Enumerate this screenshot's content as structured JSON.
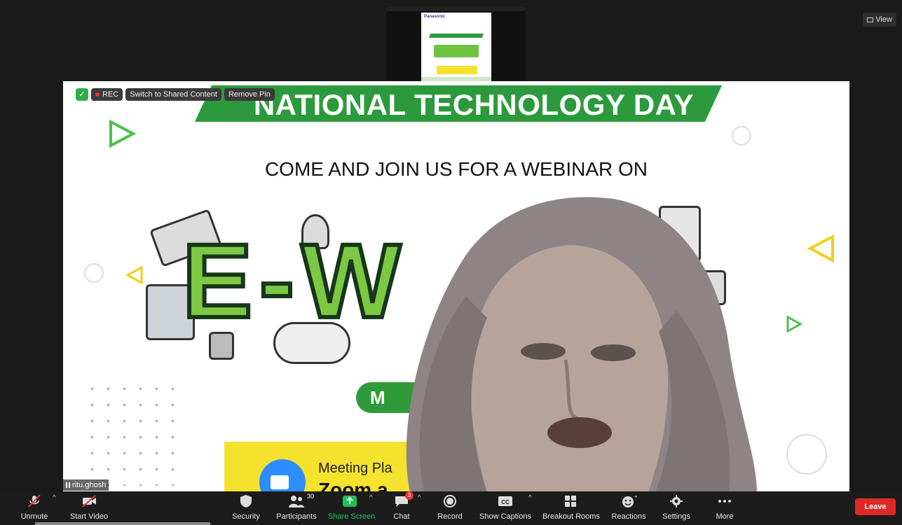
{
  "window": {
    "view_label": "View"
  },
  "slide": {
    "banner": "NATIONAL TECHNOLOGY DAY",
    "subtitle": "COME AND JOIN US FOR A WEBINAR ON",
    "main_word": "E-W",
    "pill_text": "M",
    "meeting_line1": "Meeting Pla",
    "meeting_line2": "Zoom a"
  },
  "pinned_controls": {
    "rec_label": "REC",
    "switch_label": "Switch to Shared Content",
    "remove_pin_label": "Remove Pin"
  },
  "participant": {
    "name": "ritu.ghosh"
  },
  "toolbar": {
    "unmute": "Unmute",
    "start_video": "Start Video",
    "security": "Security",
    "participants": "Participants",
    "participants_count": "30",
    "share_screen": "Share Screen",
    "chat": "Chat",
    "chat_badge": "3",
    "record": "Record",
    "show_captions": "Show Captions",
    "breakout_rooms": "Breakout Rooms",
    "reactions": "Reactions",
    "settings": "Settings",
    "more": "More",
    "leave": "Leave"
  },
  "colors": {
    "brand_green": "#2c9a3c",
    "ewaste_green": "#7cc843",
    "leave_red": "#e02828",
    "share_green": "#1fc05a"
  }
}
